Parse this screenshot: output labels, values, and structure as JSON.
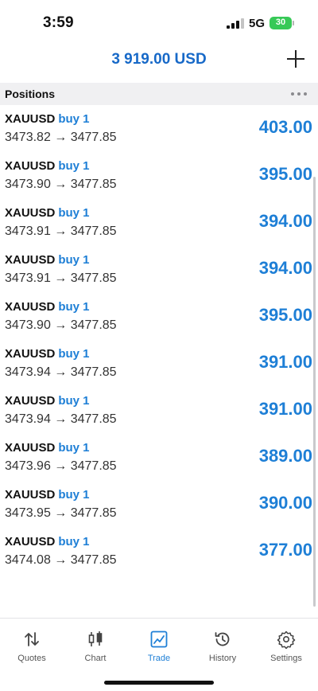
{
  "status": {
    "time": "3:59",
    "network": "5G",
    "battery": "30"
  },
  "header": {
    "balance": "3 919.00 USD"
  },
  "positions": {
    "title": "Positions",
    "items": [
      {
        "symbol": "XAUUSD",
        "side": "buy 1",
        "prices": "3473.82 → 3477.85",
        "profit": "403.00"
      },
      {
        "symbol": "XAUUSD",
        "side": "buy 1",
        "prices": "3473.90 → 3477.85",
        "profit": "395.00"
      },
      {
        "symbol": "XAUUSD",
        "side": "buy 1",
        "prices": "3473.91 → 3477.85",
        "profit": "394.00"
      },
      {
        "symbol": "XAUUSD",
        "side": "buy 1",
        "prices": "3473.91 → 3477.85",
        "profit": "394.00"
      },
      {
        "symbol": "XAUUSD",
        "side": "buy 1",
        "prices": "3473.90 → 3477.85",
        "profit": "395.00"
      },
      {
        "symbol": "XAUUSD",
        "side": "buy 1",
        "prices": "3473.94 → 3477.85",
        "profit": "391.00"
      },
      {
        "symbol": "XAUUSD",
        "side": "buy 1",
        "prices": "3473.94 → 3477.85",
        "profit": "391.00"
      },
      {
        "symbol": "XAUUSD",
        "side": "buy 1",
        "prices": "3473.96 → 3477.85",
        "profit": "389.00"
      },
      {
        "symbol": "XAUUSD",
        "side": "buy 1",
        "prices": "3473.95 → 3477.85",
        "profit": "390.00"
      },
      {
        "symbol": "XAUUSD",
        "side": "buy 1",
        "prices": "3474.08 → 3477.85",
        "profit": "377.00"
      }
    ]
  },
  "tabs": [
    {
      "label": "Quotes",
      "icon": "quotes-arrows-icon"
    },
    {
      "label": "Chart",
      "icon": "candlestick-icon"
    },
    {
      "label": "Trade",
      "icon": "trade-chart-icon",
      "active": true
    },
    {
      "label": "History",
      "icon": "history-clock-icon"
    },
    {
      "label": "Settings",
      "icon": "gear-icon"
    }
  ],
  "colors": {
    "accent": "#1e7fd6",
    "balance": "#1769c8",
    "battery": "#37c957",
    "section_bg": "#f0f0f2"
  }
}
